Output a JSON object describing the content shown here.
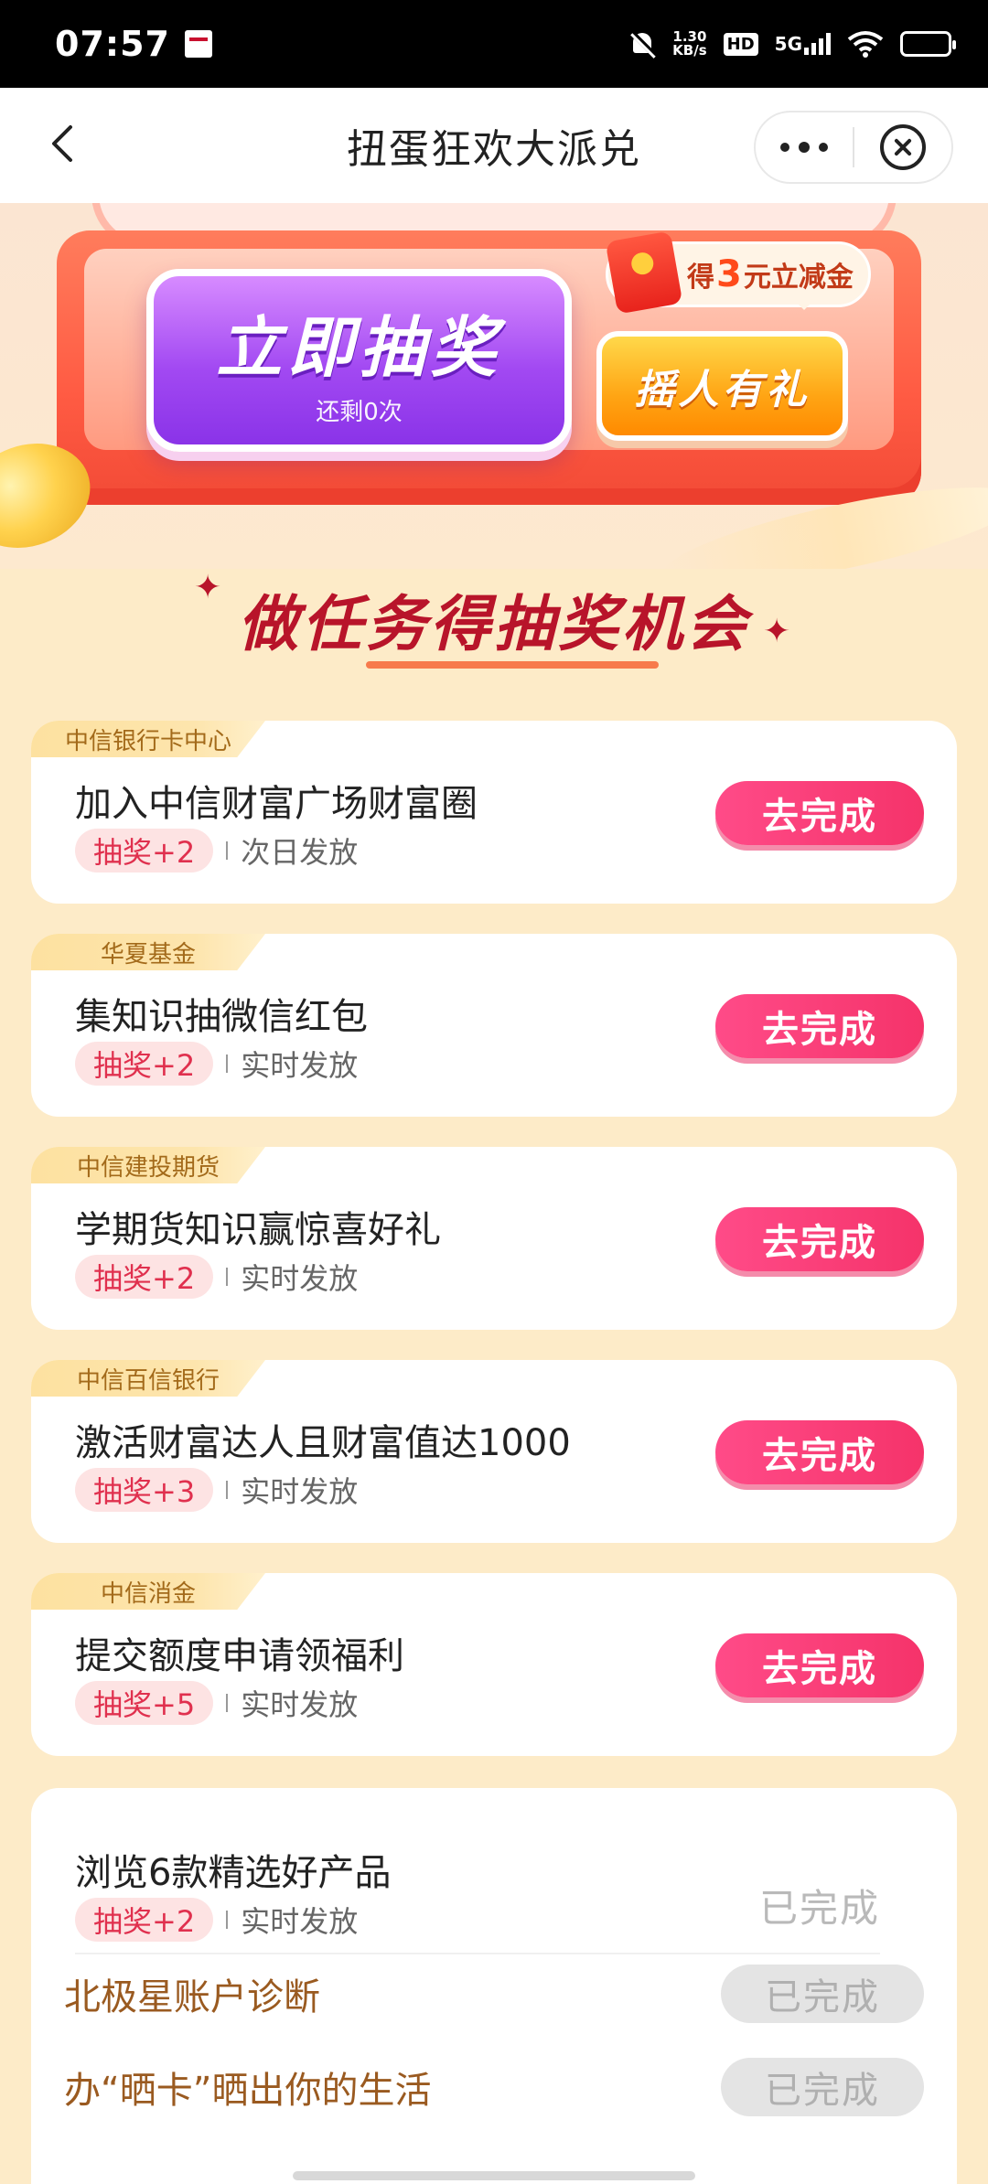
{
  "status_bar": {
    "time": "07:57",
    "net_speed_value": "1.30",
    "net_speed_unit": "KB/s",
    "hd": "HD",
    "network": "5G",
    "icons": [
      "news-app-icon",
      "bell-off-icon",
      "hd-icon",
      "signal-icon",
      "wifi-icon",
      "battery-icon"
    ]
  },
  "nav": {
    "title": "扭蛋狂欢大派兑",
    "icons": [
      "back-icon",
      "more-icon",
      "close-icon"
    ]
  },
  "hero": {
    "draw_button_label": "立即抽奖",
    "draw_button_sub": "还剩0次",
    "bubble_prefix": "得",
    "bubble_amount": "3",
    "bubble_suffix": "元立减金",
    "invite_button_label": "摇人有礼",
    "colors": {
      "draw": "#a249f2",
      "invite": "#ffa514",
      "machine": "#ff5b43"
    }
  },
  "section": {
    "title": "做任务得抽奖机会"
  },
  "tasks": [
    {
      "sponsor": "中信银行卡中心",
      "title": "加入中信财富广场财富圈",
      "reward": "抽奖+2",
      "release": "次日发放",
      "button": "去完成"
    },
    {
      "sponsor": "华夏基金",
      "title": "集知识抽微信红包",
      "reward": "抽奖+2",
      "release": "实时发放",
      "button": "去完成"
    },
    {
      "sponsor": "中信建投期货",
      "title": "学期货知识赢惊喜好礼",
      "reward": "抽奖+2",
      "release": "实时发放",
      "button": "去完成"
    },
    {
      "sponsor": "中信百信银行",
      "title": "激活财富达人且财富值达1000",
      "reward": "抽奖+3",
      "release": "实时发放",
      "button": "去完成"
    },
    {
      "sponsor": "中信消金",
      "title": "提交额度申请领福利",
      "reward": "抽奖+5",
      "release": "实时发放",
      "button": "去完成"
    }
  ],
  "completed_task": {
    "title": "浏览6款精选好产品",
    "reward": "抽奖+2",
    "release": "实时发放",
    "status": "已完成",
    "sub_items": [
      {
        "label": "北极星账户诊断",
        "status": "已完成"
      },
      {
        "label": "办“晒卡”晒出你的生活",
        "status": "已完成"
      }
    ]
  },
  "colors": {
    "accent": "#f5336a",
    "reward_text": "#e0304e",
    "title_red": "#b8142a",
    "page_bg": "#fdebc8"
  }
}
